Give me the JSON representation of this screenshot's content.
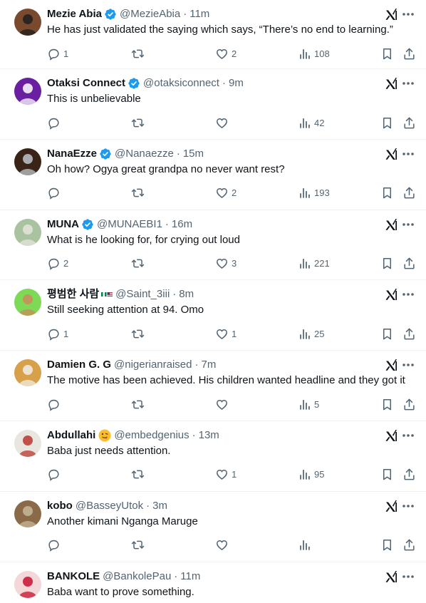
{
  "tweets": [
    {
      "name": "Mezie Abia",
      "verified": true,
      "flag": false,
      "emoji": false,
      "handle": "@MezieAbia",
      "time": "11m",
      "text": "He has just validated the saying which says, “There’s no end to learning.”",
      "replies": "1",
      "reposts": "",
      "likes": "2",
      "views": "108",
      "avatar_colors": [
        "#7a4a2e",
        "#1d1d1d"
      ]
    },
    {
      "name": "Otaksi Connect",
      "verified": true,
      "flag": false,
      "emoji": false,
      "handle": "@otaksiconnect",
      "time": "9m",
      "text": "This is unbelievable",
      "replies": "",
      "reposts": "",
      "likes": "",
      "views": "42",
      "avatar_colors": [
        "#6a1fa0",
        "#ffffff"
      ]
    },
    {
      "name": "NanaEzze",
      "verified": true,
      "flag": false,
      "emoji": false,
      "handle": "@Nanaezze",
      "time": "15m",
      "text": "Oh how? Ogya great grandpa no never want rest?",
      "replies": "",
      "reposts": "",
      "likes": "2",
      "views": "193",
      "avatar_colors": [
        "#3a2418",
        "#c0c6cc"
      ]
    },
    {
      "name": "MUNA",
      "verified": true,
      "flag": false,
      "emoji": false,
      "handle": "@MUNAEBI1",
      "time": "16m",
      "text": "What is he looking for, for crying out loud",
      "replies": "2",
      "reposts": "",
      "likes": "3",
      "views": "221",
      "avatar_colors": [
        "#a9c3a0",
        "#e8e4dc"
      ]
    },
    {
      "name": "평범한 사람",
      "verified": false,
      "flag": true,
      "emoji": false,
      "handle": "@Saint_3iii",
      "time": "8m",
      "text": "Still seeking attention at 94. Omo",
      "replies": "1",
      "reposts": "",
      "likes": "1",
      "views": "25",
      "avatar_colors": [
        "#7ed957",
        "#c98b5a"
      ]
    },
    {
      "name": "Damien G. G",
      "verified": false,
      "flag": false,
      "emoji": false,
      "handle": "@nigerianraised",
      "time": "7m",
      "text": "The motive has been achieved. His children wanted headline and they got it",
      "replies": "",
      "reposts": "",
      "likes": "",
      "views": "5",
      "avatar_colors": [
        "#d7a04a",
        "#f2efe6"
      ]
    },
    {
      "name": "Abdullahi",
      "verified": false,
      "flag": false,
      "emoji": true,
      "handle": "@embedgenius",
      "time": "13m",
      "text": "Baba just needs attention.",
      "replies": "",
      "reposts": "",
      "likes": "1",
      "views": "95",
      "avatar_colors": [
        "#e9e6e0",
        "#b8352e"
      ]
    },
    {
      "name": "kobo",
      "verified": false,
      "flag": false,
      "emoji": false,
      "handle": "@BasseyUtok",
      "time": "3m",
      "text": "Another kimani Nganga Maruge",
      "replies": "",
      "reposts": "",
      "likes": "",
      "views": "",
      "avatar_colors": [
        "#8b6a4a",
        "#c7b79a"
      ]
    },
    {
      "name": "BANKOLE",
      "verified": false,
      "flag": false,
      "emoji": false,
      "handle": "@BankolePau",
      "time": "11m",
      "text": "Baba want to prove something.",
      "replies": "",
      "reposts": "",
      "likes": "",
      "views": "",
      "avatar_colors": [
        "#f3d7d9",
        "#c8102e"
      ]
    }
  ],
  "colors": {
    "verified": "#1d9bf0",
    "muted": "#536471",
    "text": "#0f1419",
    "divider": "#eff3f4"
  },
  "icons": {
    "reply": "reply-icon",
    "repost": "repost-icon",
    "like": "heart-icon",
    "views": "views-chart-icon",
    "bookmark": "bookmark-icon",
    "share": "share-icon",
    "grok": "grok-icon",
    "more": "more-dots-icon"
  }
}
